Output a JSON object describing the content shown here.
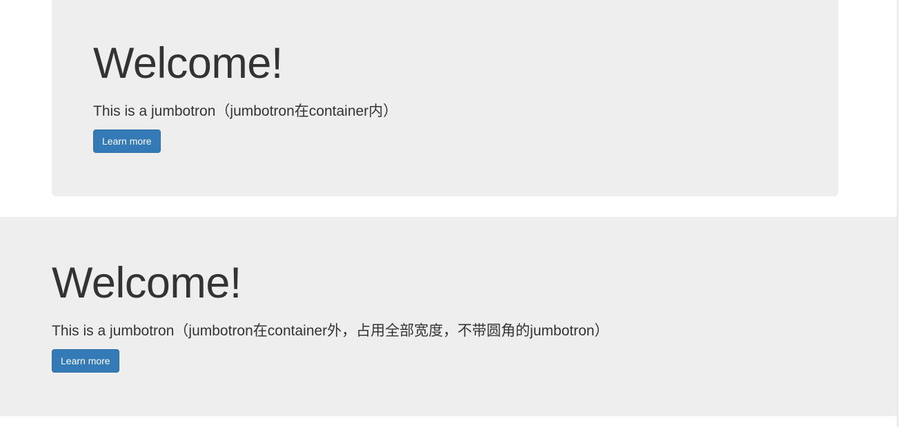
{
  "contained_jumbotron": {
    "heading": "Welcome!",
    "lead": "This is a jumbotron（jumbotron在container内）",
    "button_label": "Learn more"
  },
  "fluid_jumbotron": {
    "heading": "Welcome!",
    "lead": "This is a jumbotron（jumbotron在container外，占用全部宽度，不带圆角的jumbotron）",
    "button_label": "Learn more"
  },
  "colors": {
    "jumbotron_background": "#eeeeee",
    "button_primary": "#337ab7",
    "text": "#333333"
  }
}
